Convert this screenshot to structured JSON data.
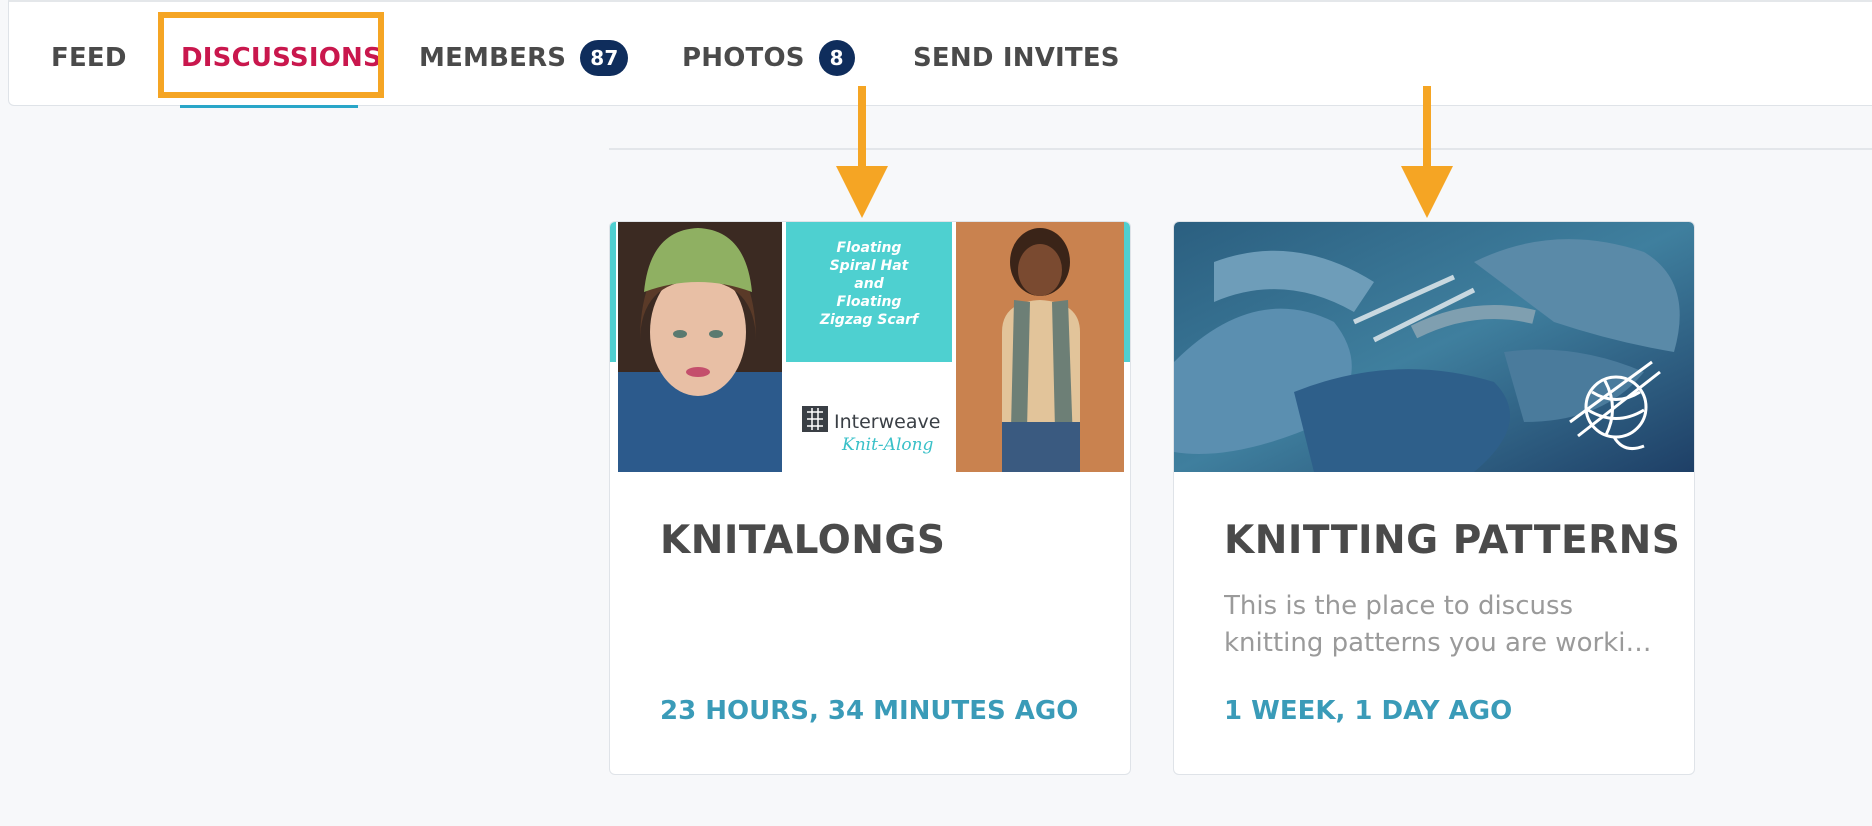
{
  "tabs": [
    {
      "label": "FEED"
    },
    {
      "label": "DISCUSSIONS"
    },
    {
      "label": "MEMBERS",
      "badge": "87"
    },
    {
      "label": "PHOTOS",
      "badge": "8"
    },
    {
      "label": "SEND INVITES"
    }
  ],
  "active_tab": "DISCUSSIONS",
  "colors": {
    "active_tab": "#c9174d",
    "badge": "#0f2d5c",
    "highlight": "#f5a524",
    "timestamp": "#3a9bb8"
  },
  "cards": [
    {
      "title": "KNITALONGS",
      "description": [],
      "time": "23 HOURS, 34 MINUTES AGO",
      "image": {
        "banner_text": [
          "Floating",
          "Spiral Hat",
          "and",
          "Floating",
          "Zigzag Scarf"
        ],
        "brand": "Interweave",
        "brand_script": "Knit-Along"
      }
    },
    {
      "title": "KNITTING PATTERNS",
      "description": [
        "This is the place to discuss",
        "knitting patterns you are worki…"
      ],
      "time": "1 WEEK, 1 DAY AGO",
      "image": {
        "icon": "yarn-ball-icon"
      }
    }
  ]
}
